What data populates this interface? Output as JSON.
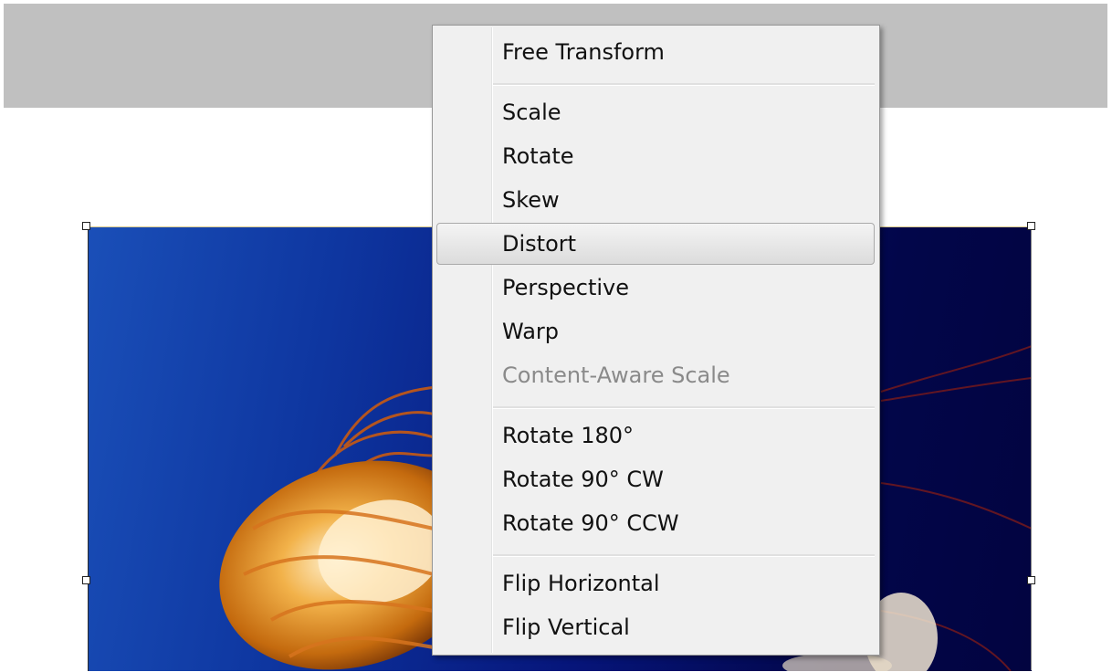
{
  "canvas": {
    "image_subject": "jellyfish"
  },
  "context_menu": {
    "items": [
      {
        "label": "Free Transform"
      },
      {
        "label": "Scale"
      },
      {
        "label": "Rotate"
      },
      {
        "label": "Skew"
      },
      {
        "label": "Distort",
        "highlighted": true
      },
      {
        "label": "Perspective"
      },
      {
        "label": "Warp"
      },
      {
        "label": "Content-Aware Scale",
        "disabled": true
      },
      {
        "label": "Rotate 180°"
      },
      {
        "label": "Rotate 90° CW"
      },
      {
        "label": "Rotate 90° CCW"
      },
      {
        "label": "Flip Horizontal"
      },
      {
        "label": "Flip Vertical"
      }
    ]
  },
  "colors": {
    "menu_background": "#f0f0f0",
    "toolbar_gray": "#c0c0c0",
    "image_blue": "#0e36a0"
  }
}
